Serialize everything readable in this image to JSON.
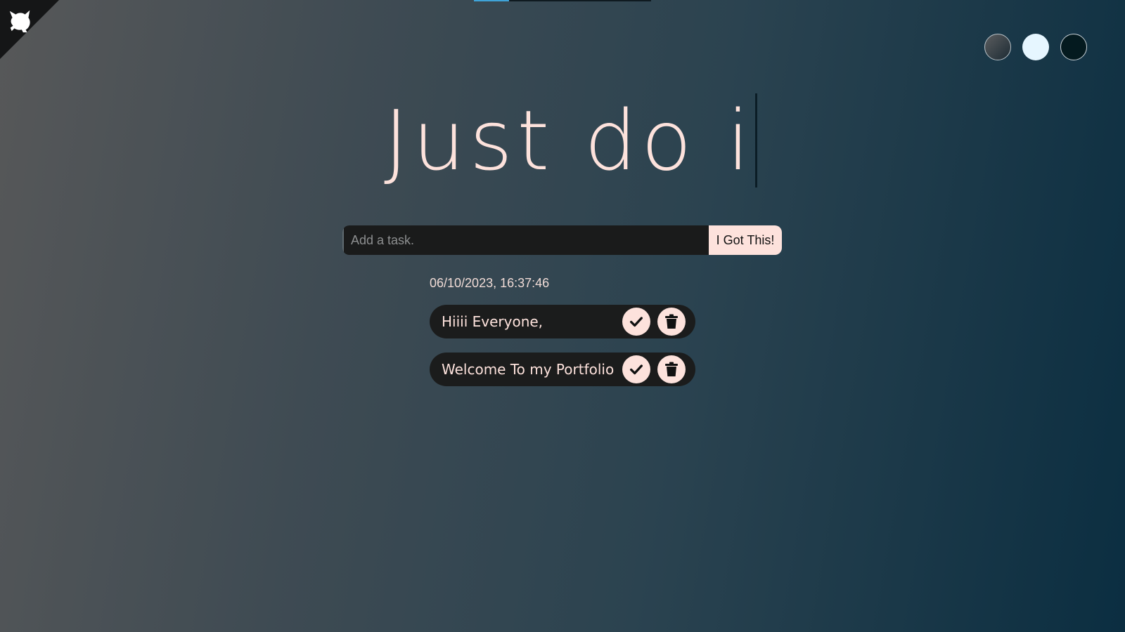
{
  "header": {
    "title": "Just do i",
    "logo_icon": "cat-silhouette-icon",
    "theme_options": [
      "standard-theme",
      "light-theme",
      "darker-theme"
    ]
  },
  "form": {
    "placeholder": "Add a task.",
    "value": "",
    "submit_label": "I Got This!"
  },
  "datetime": "06/10/2023, 16:37:46",
  "tasks": [
    {
      "text": "Hiiii Everyone,",
      "check_icon": "check-icon",
      "delete_icon": "trash-icon"
    },
    {
      "text": "Welcome To my Portfolio",
      "check_icon": "check-icon",
      "delete_icon": "trash-icon"
    }
  ],
  "colors": {
    "accent": "#fde2dc",
    "input_bg": "#1a1b1b",
    "task_bg": "#1b1c1c",
    "gradient_start": "#575859",
    "gradient_end": "#0b2e41"
  }
}
